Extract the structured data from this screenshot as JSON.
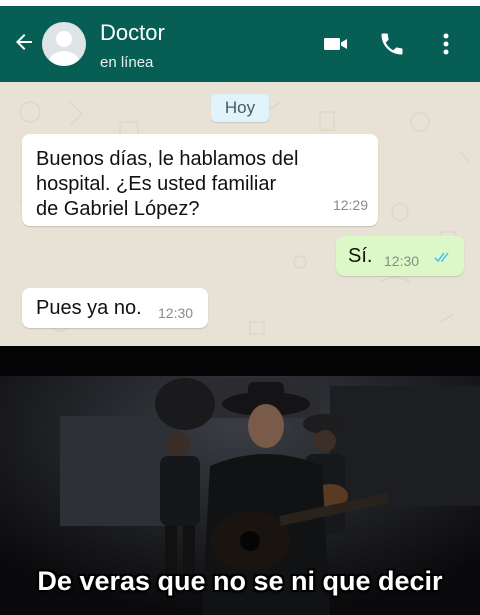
{
  "header": {
    "contact_name": "Doctor",
    "status": "en línea",
    "icons": [
      "back-arrow-icon",
      "avatar",
      "video-call-icon",
      "phone-call-icon",
      "more-options-icon"
    ],
    "color": "#075e54"
  },
  "chat": {
    "date_label": "Hoy",
    "messages": [
      {
        "direction": "incoming",
        "lines": [
          "Buenos días, le hablamos del",
          "hospital. ¿Es usted familiar",
          "de Gabriel López?"
        ],
        "time": "12:29"
      },
      {
        "direction": "outgoing",
        "text": "Sí.",
        "time": "12:30",
        "status": "read"
      },
      {
        "direction": "incoming",
        "text": "Pues ya no.",
        "time": "12:30"
      }
    ],
    "colors": {
      "incoming": "#ffffff",
      "outgoing": "#dcf8c6",
      "background": "#e8e2d6",
      "read_ticks": "#4fc3f7"
    }
  },
  "meme": {
    "caption": "De veras que no se ni que decir"
  }
}
